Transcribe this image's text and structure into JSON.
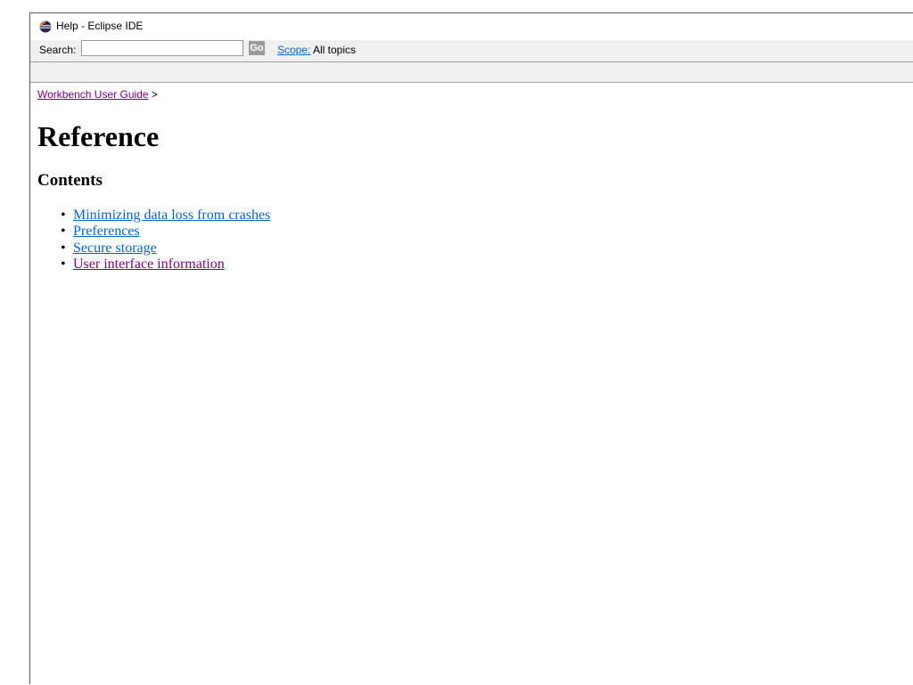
{
  "window": {
    "title": "Help - Eclipse IDE",
    "icon": "eclipse-icon"
  },
  "toolbar": {
    "search_label": "Search:",
    "search_value": "",
    "go_label": "Go",
    "scope_label": "Scope:",
    "scope_value": "All topics"
  },
  "breadcrumb": {
    "link_label": "Workbench User Guide",
    "separator": ">"
  },
  "page": {
    "title": "Reference",
    "section_title": "Contents",
    "items": [
      {
        "label": "Minimizing data loss from crashes",
        "visited": false
      },
      {
        "label": "Preferences",
        "visited": false
      },
      {
        "label": "Secure storage",
        "visited": false
      },
      {
        "label": "User interface information",
        "visited": true
      }
    ]
  },
  "colors": {
    "link": "#0066cc",
    "visited_link": "#800080",
    "toolbar_bg": "#f0f0f0",
    "go_button_bg": "#9b9b9b"
  }
}
